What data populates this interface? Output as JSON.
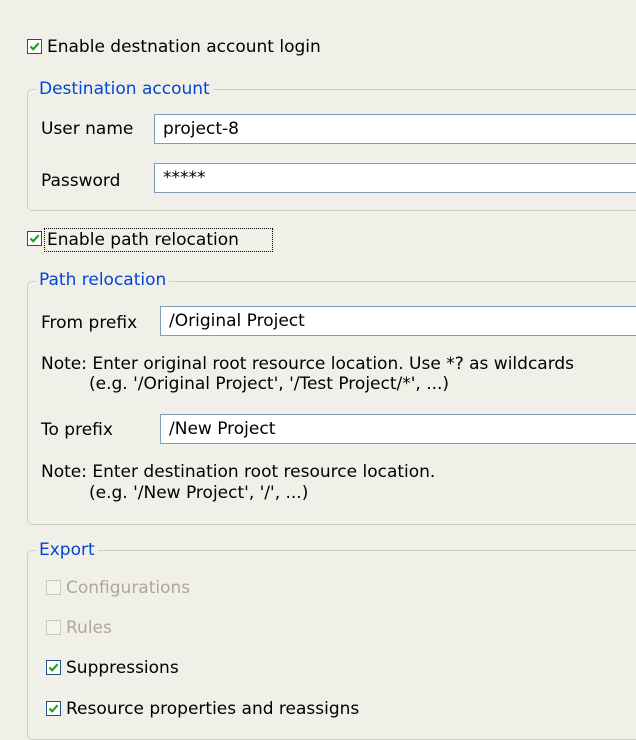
{
  "enable_login": {
    "label": "Enable destnation account login",
    "checked": true
  },
  "destination_account": {
    "legend": "Destination account",
    "username_label": "User name",
    "username_value": "project-8",
    "password_label": "Password",
    "password_value": "*****"
  },
  "enable_relocation": {
    "label": "Enable path relocation",
    "checked": true
  },
  "path_relocation": {
    "legend": "Path relocation",
    "from_label": "From prefix",
    "from_value": "/Original Project",
    "from_note_1": "Note: Enter original root resource location. Use *? as wildcards",
    "from_note_2": "(e.g. '/Original Project', '/Test Project/*', ...)",
    "to_label": "To prefix",
    "to_value": "/New Project",
    "to_note_1": "Note: Enter destination root resource location.",
    "to_note_2": "(e.g. '/New Project', '/', ...)"
  },
  "export": {
    "legend": "Export",
    "items": [
      {
        "label": "Configurations",
        "checked": false,
        "enabled": false
      },
      {
        "label": "Rules",
        "checked": false,
        "enabled": false
      },
      {
        "label": "Suppressions",
        "checked": true,
        "enabled": true
      },
      {
        "label": "Resource properties and reassigns",
        "checked": true,
        "enabled": true
      }
    ]
  },
  "colors": {
    "background": "#f1f0e8",
    "legend_text": "#0046d5",
    "checkmark": "#21a121",
    "checkbox_border": "#1c5180",
    "field_border": "#7f9db9",
    "disabled_text": "#aca899"
  }
}
